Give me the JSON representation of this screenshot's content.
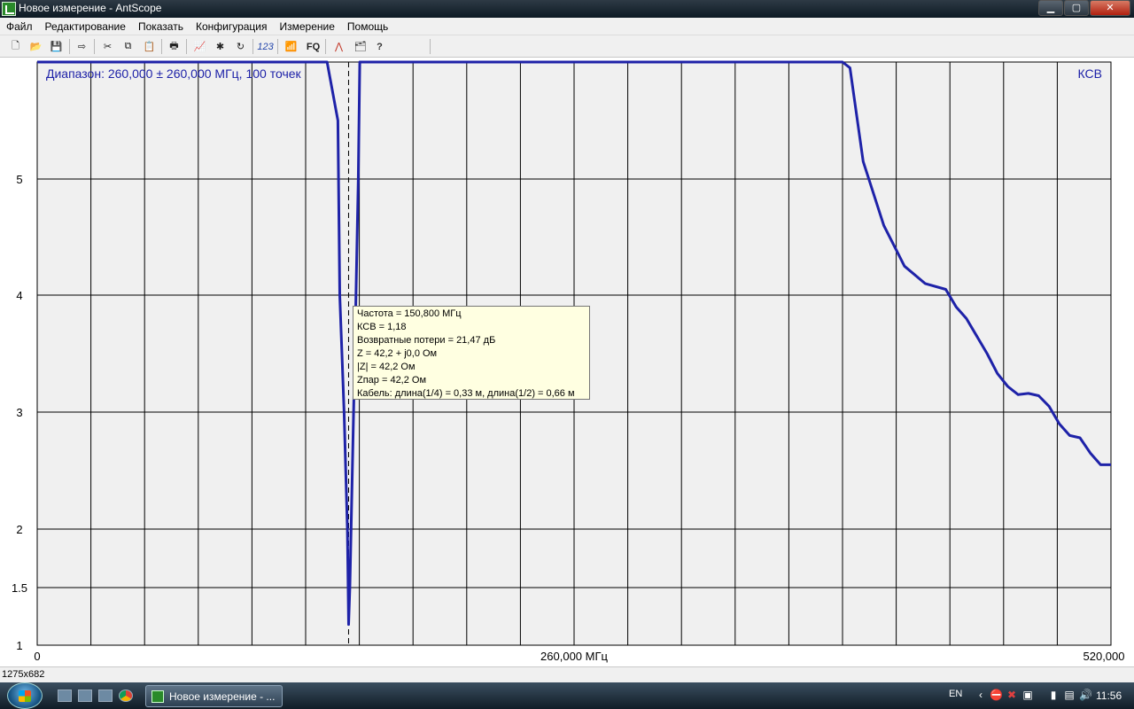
{
  "window": {
    "title": "Новое измерение - AntScope",
    "minimize_glyph": "▁",
    "maximize_glyph": "▢",
    "close_glyph": "✕"
  },
  "menu": [
    "Файл",
    "Редактирование",
    "Показать",
    "Конфигурация",
    "Измерение",
    "Помощь"
  ],
  "toolbar": {
    "buttons": [
      {
        "name": "new-file-icon",
        "glyph": "🗋"
      },
      {
        "name": "open-folder-icon",
        "glyph": "📂"
      },
      {
        "name": "save-icon",
        "glyph": "💾"
      },
      {
        "name": "export-icon",
        "glyph": "⇨"
      },
      {
        "name": "cut-icon",
        "glyph": "✂"
      },
      {
        "name": "copy-icon",
        "glyph": "⧉"
      },
      {
        "name": "paste-icon",
        "glyph": "📋"
      },
      {
        "name": "print-icon",
        "glyph": "🖶"
      },
      {
        "name": "chart-icon",
        "glyph": "📈"
      },
      {
        "name": "scan-icon",
        "glyph": "✱"
      },
      {
        "name": "refresh-icon",
        "glyph": "↻"
      },
      {
        "name": "numeric-icon",
        "glyph": "123"
      },
      {
        "name": "antenna-icon",
        "glyph": "📶"
      },
      {
        "name": "fq-icon",
        "glyph": "FQ"
      },
      {
        "name": "marker-icon",
        "glyph": "⋀"
      },
      {
        "name": "folder-list-icon",
        "glyph": "🗂"
      },
      {
        "name": "help-icon",
        "glyph": "?"
      }
    ]
  },
  "chart_data": {
    "type": "line",
    "title": "Диапазон: 260,000 ± 260,000 МГц, 100 точек",
    "series_label": "КСВ",
    "xlabel": "260,000 МГц",
    "xlim": [
      0,
      520
    ],
    "x_tick_labels": [
      "0",
      "260,000 МГц",
      "520,000"
    ],
    "y_tick_labels": [
      "1",
      "1.5",
      "2",
      "3",
      "4",
      "5"
    ],
    "y_scale": "nonlinear (SWR scale)",
    "grid": true,
    "color": "#1e22a8",
    "marker_x": 150.8,
    "series": [
      {
        "x": [
          0,
          140.4,
          145.6,
          146.5,
          148.6,
          150.2,
          150.8,
          151.4,
          152.6,
          153.8,
          155.5,
          156.2,
          390.0,
          393.6,
          400.0,
          410.0,
          420.0,
          430.0,
          440.0,
          445.0,
          450.0,
          455.0,
          460.0,
          465.0,
          470.0,
          475.0,
          480.0,
          485.0,
          490.0,
          495.0,
          500.0,
          505.0,
          510.0,
          515.0,
          520.0
        ],
        "y": [
          6.0,
          6.0,
          5.5,
          4.0,
          3.0,
          2.0,
          1.18,
          1.5,
          2.5,
          3.5,
          5.0,
          6.0,
          6.0,
          5.95,
          5.15,
          4.6,
          4.25,
          4.1,
          4.05,
          3.9,
          3.8,
          3.65,
          3.5,
          3.33,
          3.22,
          3.15,
          3.16,
          3.14,
          3.05,
          2.9,
          2.8,
          2.78,
          2.65,
          2.55,
          2.55
        ]
      }
    ]
  },
  "tooltip": {
    "lines": [
      "Частота = 150,800 МГц",
      "КСВ = 1,18",
      "Возвратные потери = 21,47 дБ",
      "Z = 42,2 + j0,0 Ом",
      "|Z| = 42,2 Ом",
      "Zпар = 42,2 Ом",
      "Кабель: длина(1/4) = 0,33 м, длина(1/2) = 0,66 м"
    ]
  },
  "statusbar": {
    "text": "1275x682"
  },
  "taskbar": {
    "task_label": "Новое измерение - ...",
    "language": "EN",
    "clock": "11:56",
    "tray_glyphs": [
      "‹",
      "⛔",
      "✖",
      "▣",
      "▮",
      "▤",
      "🔊"
    ]
  }
}
